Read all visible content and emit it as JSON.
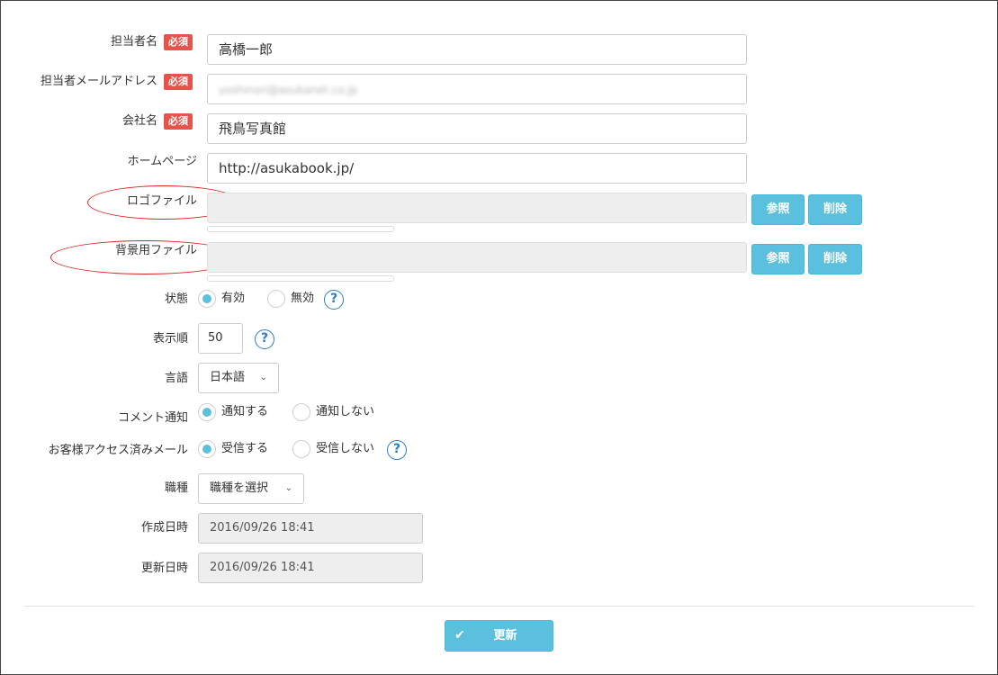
{
  "required_badge": "必須",
  "fields": {
    "person_name": {
      "label": "担当者名",
      "value": "高橋一郎"
    },
    "person_email": {
      "label": "担当者メールアドレス",
      "value": "yoshinori@asukanet.co.jp"
    },
    "company": {
      "label": "会社名",
      "value": "飛鳥写真館"
    },
    "homepage": {
      "label": "ホームページ",
      "value": "http://asukabook.jp/"
    },
    "logo_file": {
      "label": "ロゴファイル"
    },
    "background_file": {
      "label": "背景用ファイル"
    },
    "status": {
      "label": "状態",
      "options": [
        "有効",
        "無効"
      ],
      "selected": "有効"
    },
    "display_order": {
      "label": "表示順",
      "value": "50"
    },
    "language": {
      "label": "言語",
      "value": "日本語"
    },
    "comment_notify": {
      "label": "コメント通知",
      "options": [
        "通知する",
        "通知しない"
      ],
      "selected": "通知する"
    },
    "access_mail": {
      "label": "お客様アクセス済みメール",
      "options": [
        "受信する",
        "受信しない"
      ],
      "selected": "受信する"
    },
    "job_type": {
      "label": "職種",
      "value": "職種を選択"
    },
    "created_at": {
      "label": "作成日時",
      "value": "2016/09/26 18:41"
    },
    "updated_at": {
      "label": "更新日時",
      "value": "2016/09/26 18:41"
    }
  },
  "buttons": {
    "browse": "参照",
    "delete": "削除",
    "update": "更新"
  },
  "help_glyph": "?",
  "colors": {
    "accent": "#5bc0de",
    "required": "#e5534b",
    "annotation": "#d9251c",
    "help": "#2a7fc1"
  },
  "icons": {
    "chevron": "chevron-down-icon",
    "check": "check-icon",
    "help": "help-circle-icon"
  }
}
